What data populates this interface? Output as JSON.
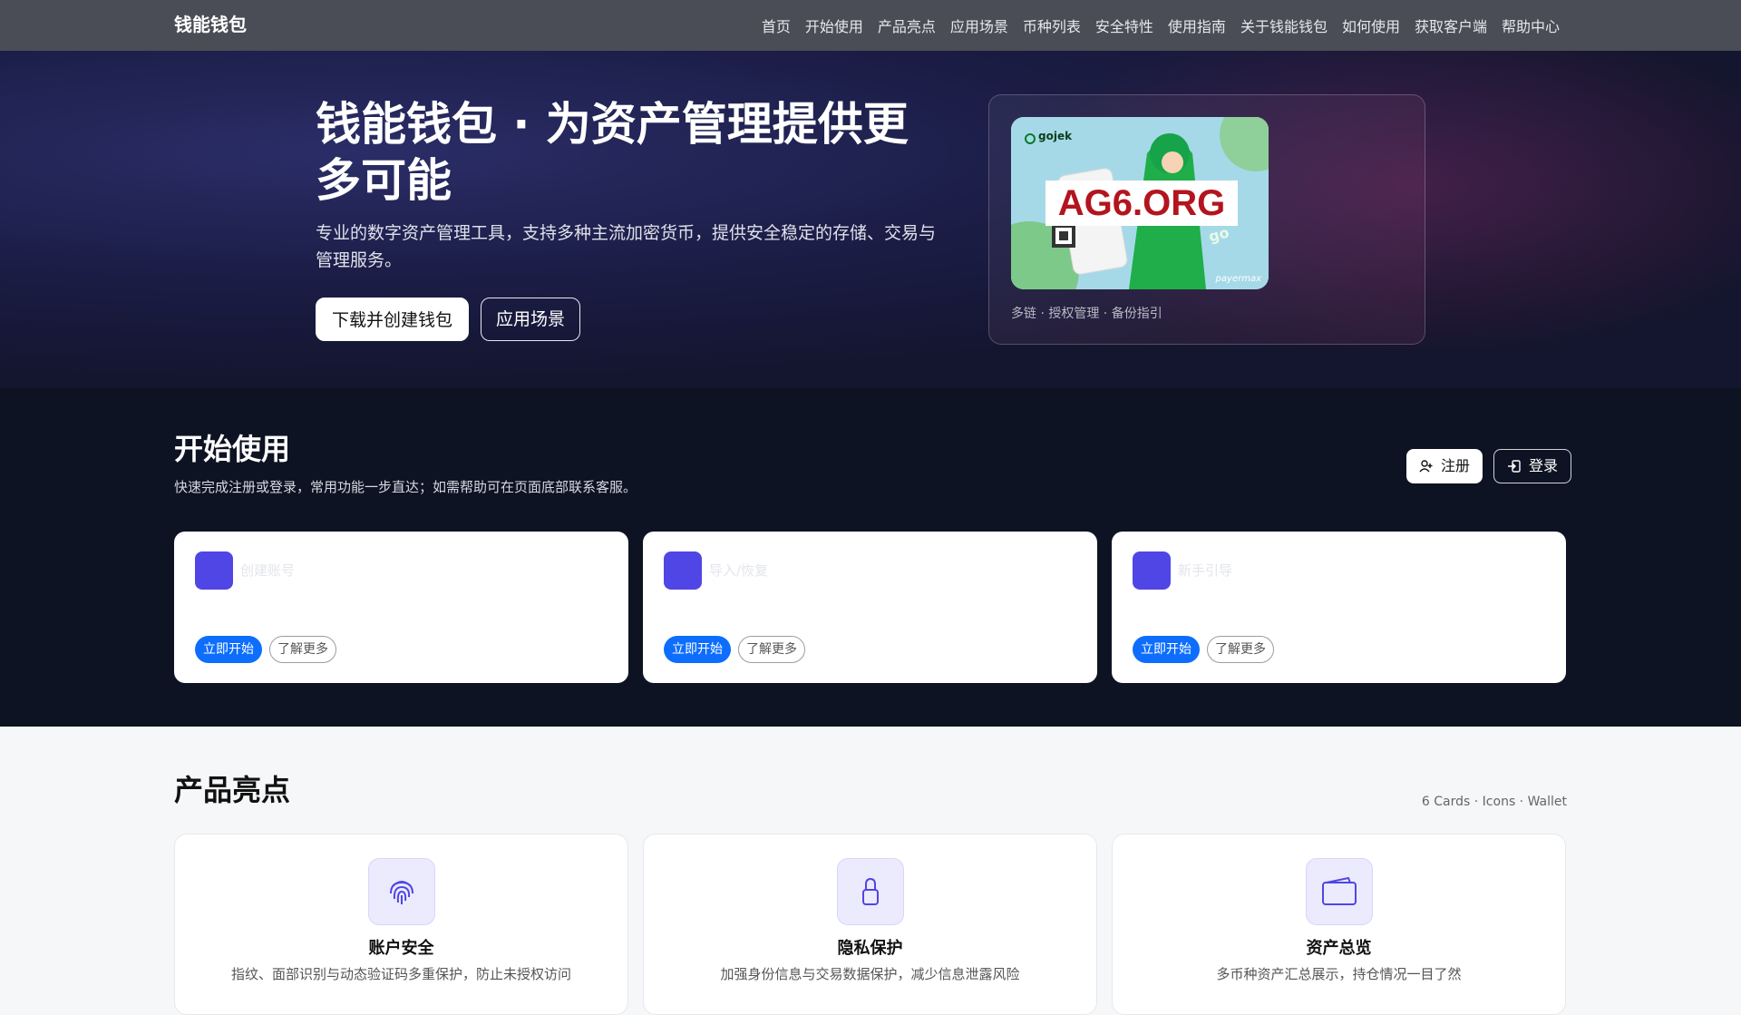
{
  "navbar": {
    "brand": "钱能钱包",
    "links": [
      "首页",
      "开始使用",
      "产品亮点",
      "应用场景",
      "币种列表",
      "安全特性",
      "使用指南",
      "关于钱能钱包",
      "如何使用",
      "获取客户端",
      "帮助中心"
    ]
  },
  "hero": {
    "title": "钱能钱包 · 为资产管理提供更多可能",
    "subtitle": "专业的数字资产管理工具，支持多种主流加密货币，提供安全稳定的存储、交易与管理服务。",
    "primary_button": "下载并创建钱包",
    "secondary_button": "应用场景",
    "card_image": {
      "brand_text": "gojek",
      "overlay_text": "AG6.ORG",
      "corner_text": "payermax",
      "side_text": "go"
    },
    "card_caption": "多链 · 授权管理 · 备份指引"
  },
  "start": {
    "title": "开始使用",
    "description": "快速完成注册或登录，常用功能一步直达；如需帮助可在页面底部联系客服。",
    "register_label": "注册",
    "login_label": "登录",
    "cards": [
      {
        "title": "创建账号",
        "go_label": "立即开始",
        "more_label": "了解更多"
      },
      {
        "title": "导入/恢复",
        "go_label": "立即开始",
        "more_label": "了解更多"
      },
      {
        "title": "新手引导",
        "go_label": "立即开始",
        "more_label": "了解更多"
      }
    ]
  },
  "highlights": {
    "title": "产品亮点",
    "meta": "6 Cards · Icons · Wallet",
    "cards": [
      {
        "icon": "fingerprint-icon",
        "name": "账户安全",
        "text": "指纹、面部识别与动态验证码多重保护，防止未授权访问"
      },
      {
        "icon": "lock-icon",
        "name": "隐私保护",
        "text": "加强身份信息与交易数据保护，减少信息泄露风险"
      },
      {
        "icon": "wallet-icon",
        "name": "资产总览",
        "text": "多币种资产汇总展示，持仓情况一目了然"
      }
    ]
  },
  "colors": {
    "nav_bg": "#4a4d55",
    "accent": "#4f46e5",
    "primary_button": "#0d6efd",
    "start_section_bg": "#0d1322"
  }
}
